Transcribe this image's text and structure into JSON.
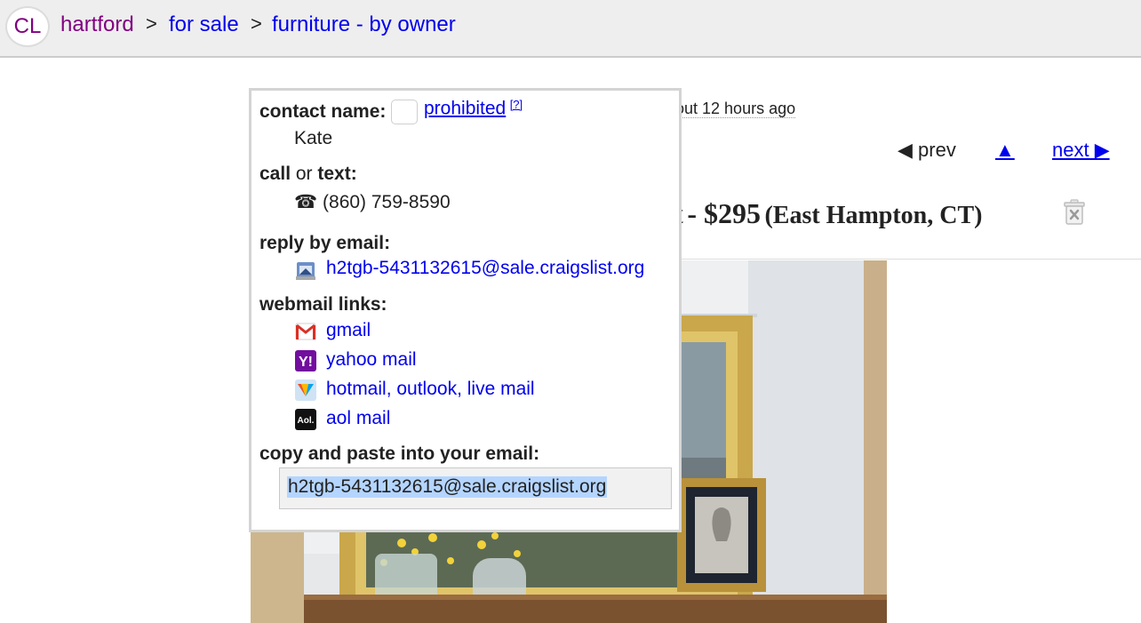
{
  "breadcrumb": {
    "logo": "CL",
    "items": [
      "hartford",
      "for sale",
      "furniture - by owner"
    ],
    "separator": ">"
  },
  "posting": {
    "posted_partial": "out 12 hours ago",
    "nav": {
      "prev": "◀ prev",
      "up": "▲",
      "next": "next ▶"
    },
    "title_fragment": "t",
    "price": "- $295",
    "location": "(East Hampton, CT)",
    "icons": {
      "hide": "trash-x-icon"
    }
  },
  "contact_popup": {
    "contact_label": "contact name:",
    "prohibited_link": "prohibited",
    "help": "[?]",
    "contact_name": "Kate",
    "call_label": "call",
    "call_or": " or ",
    "text_label": "text:",
    "phone_icon": "☎",
    "phone": "(860) 759-8590",
    "reply_label": "reply by email:",
    "reply_email": "h2tgb-5431132615@sale.craigslist.org",
    "webmail_label": "webmail links:",
    "webmail": [
      {
        "label": "gmail",
        "icon": "gmail-icon",
        "color": "#d93025"
      },
      {
        "label": "yahoo mail",
        "icon": "yahoo-icon",
        "color": "#720e9e"
      },
      {
        "label": "hotmail, outlook, live mail",
        "icon": "hotmail-icon",
        "color": "#f25022"
      },
      {
        "label": "aol mail",
        "icon": "aol-icon",
        "color": "#111111",
        "badge": "Aol."
      }
    ],
    "copy_label": "copy and paste into your email:",
    "copy_value": "h2tgb-5431132615@sale.craigslist.org"
  },
  "colors": {
    "link": "#0000ee",
    "visited": "#800080",
    "selection": "#b4d5fe"
  }
}
